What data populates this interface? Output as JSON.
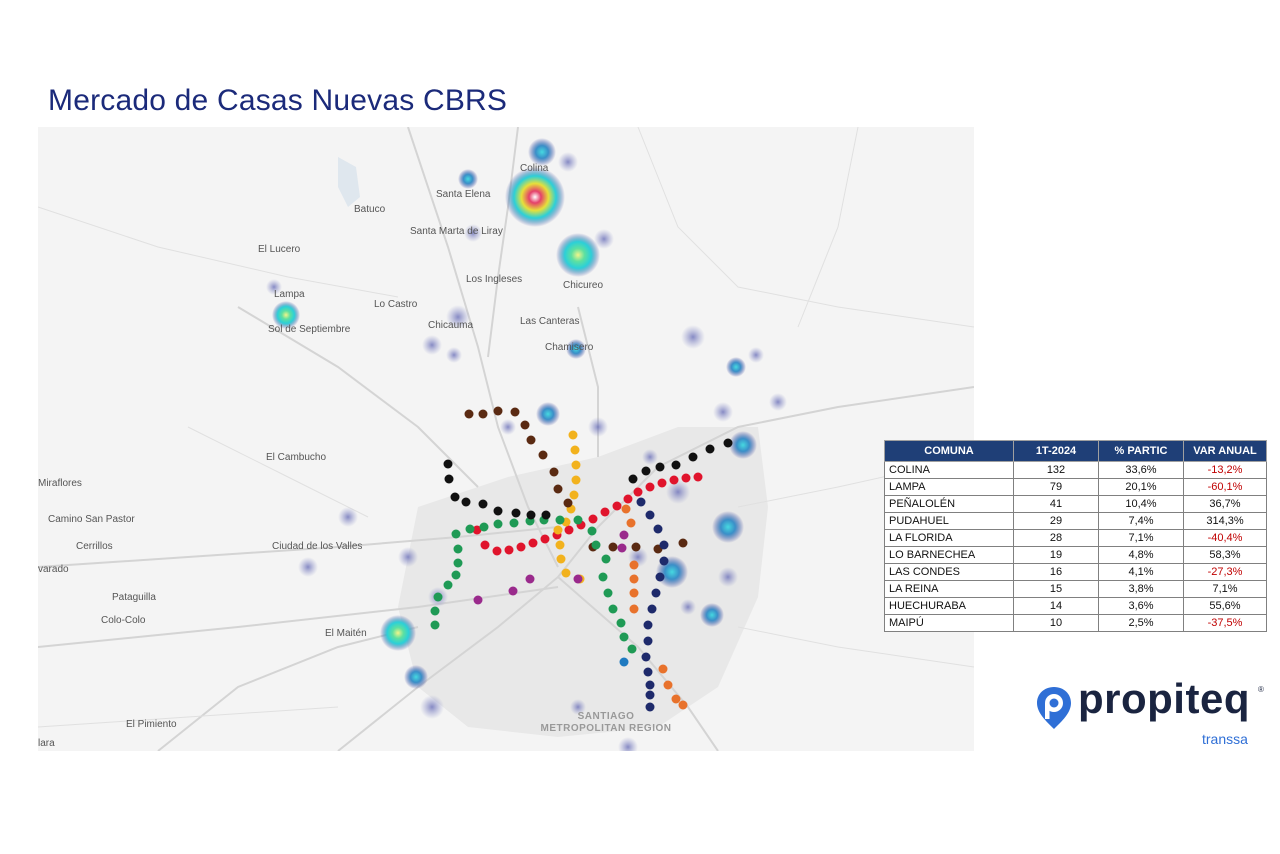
{
  "title": "Mercado de Casas Nuevas CBRS",
  "map": {
    "places": [
      "Colina",
      "Santa Elena",
      "Batuco",
      "Santa Marta de Liray",
      "El Lucero",
      "Los Ingleses",
      "Chicureo",
      "Lampa",
      "Lo Castro",
      "Sol de Septiembre",
      "Chicauma",
      "Las Canteras",
      "Chamisero",
      "El Cambucho",
      "Miraflores",
      "Camino San Pastor",
      "Cerrillos",
      "Ciudad de los Valles",
      "varado",
      "Pataguilla",
      "Colo-Colo",
      "El Maitén",
      "El Pimiento",
      "lara"
    ],
    "region_label": [
      "SANTIAGO",
      "METROPOLITAN REGION"
    ],
    "metro_line_colors": {
      "L1": "#e0142c",
      "L2": "#f2b21d",
      "L3": "#5a2a12",
      "L4": "#1e2a6b",
      "L4A": "#1f7ac0",
      "L5": "#1f9a55",
      "L6": "#9a2a8c",
      "L7": "#111111",
      "L9": "#e8722c"
    },
    "heat_colors": [
      "#3b3f9a",
      "#2bd0d8",
      "#e7e03a",
      "#e4406a"
    ]
  },
  "table": {
    "headers": [
      "COMUNA",
      "1T-2024",
      "% PARTIC",
      "VAR ANUAL"
    ],
    "rows": [
      [
        "COLINA",
        "132",
        "33,6%",
        "-13,2%"
      ],
      [
        "LAMPA",
        "79",
        "20,1%",
        "-60,1%"
      ],
      [
        "PEÑALOLÉN",
        "41",
        "10,4%",
        "36,7%"
      ],
      [
        "PUDAHUEL",
        "29",
        "7,4%",
        "314,3%"
      ],
      [
        "LA FLORIDA",
        "28",
        "7,1%",
        "-40,4%"
      ],
      [
        "LO BARNECHEA",
        "19",
        "4,8%",
        "58,3%"
      ],
      [
        "LAS CONDES",
        "16",
        "4,1%",
        "-27,3%"
      ],
      [
        "LA REINA",
        "15",
        "3,8%",
        "7,1%"
      ],
      [
        "HUECHURABA",
        "14",
        "3,6%",
        "55,6%"
      ],
      [
        "MAIPÚ",
        "10",
        "2,5%",
        "-37,5%"
      ]
    ]
  },
  "logo": {
    "word": "propiteq",
    "sub": "transsa",
    "mark": "®",
    "icon": "location-pin-p-icon"
  }
}
